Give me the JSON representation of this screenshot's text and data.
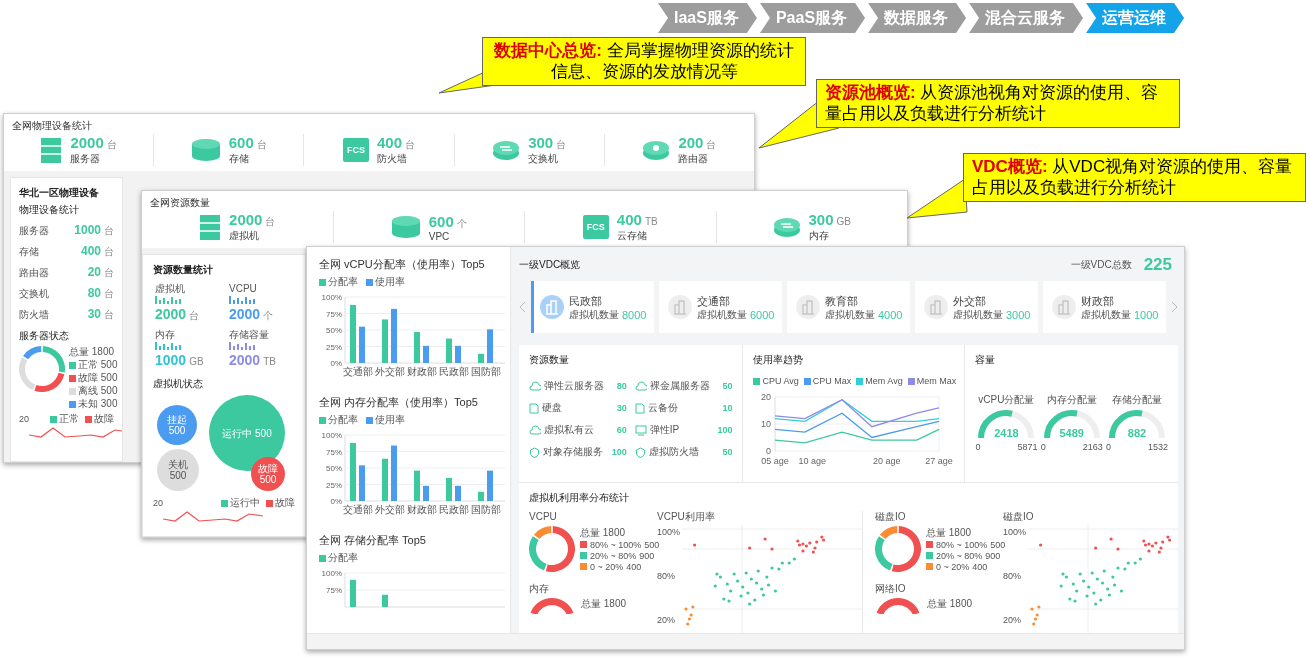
{
  "nav": {
    "steps": [
      {
        "label": "IaaS服务",
        "selected": false
      },
      {
        "label": "PaaS服务",
        "selected": false
      },
      {
        "label": "数据服务",
        "selected": false
      },
      {
        "label": "混合云服务",
        "selected": false
      },
      {
        "label": "运营运维",
        "selected": true
      }
    ]
  },
  "callouts": [
    {
      "text": "**数据中心总览:** 全局掌握物理资源的统计信息、资源的发放情况等"
    },
    {
      "text": "**资源池概览:** 从资源池视角对资源的使用、容量占用以及负载进行分析统计"
    },
    {
      "text": "**VDC概览:** 从VDC视角对资源的使用、容量占用以及负载进行分析统计"
    }
  ],
  "physical_overview": {
    "title": "全网物理设备统计",
    "stats": [
      {
        "kind": "server",
        "value": "2000",
        "unit": "台",
        "label": "服务器"
      },
      {
        "kind": "storage",
        "value": "600",
        "unit": "台",
        "label": "存储"
      },
      {
        "kind": "fcs",
        "icon_text": "FCS",
        "value": "400",
        "unit": "台",
        "label": "防火墙"
      },
      {
        "kind": "switch",
        "value": "300",
        "unit": "台",
        "label": "交换机"
      },
      {
        "kind": "router",
        "value": "200",
        "unit": "台",
        "label": "路由器"
      }
    ],
    "region": {
      "title": "华北一区物理设备",
      "subtitle": "物理设备统计",
      "rows": [
        {
          "label": "服务器",
          "value": "1000",
          "unit": "台"
        },
        {
          "label": "存储",
          "value": "400",
          "unit": "台"
        },
        {
          "label": "路由器",
          "value": "20",
          "unit": "台"
        },
        {
          "label": "交换机",
          "value": "80",
          "unit": "台"
        },
        {
          "label": "防火墙",
          "value": "30",
          "unit": "台"
        }
      ],
      "status": {
        "title": "服务器状态",
        "total": "总量 1800",
        "legend": [
          {
            "label": "正常 500",
            "color": "#3cc9a0"
          },
          {
            "label": "故障 500",
            "color": "#f05050"
          },
          {
            "label": "离线 500",
            "color": "#dddddd"
          },
          {
            "label": "未知 300",
            "color": "#4b9bf0"
          }
        ]
      },
      "trend": {
        "tick": "20",
        "legend": [
          {
            "label": "正常",
            "color": "#3cc9a0"
          },
          {
            "label": "故障",
            "color": "#f05050"
          }
        ]
      }
    }
  },
  "pool_overview": {
    "title": "全网资源数量",
    "stats": [
      {
        "kind": "server",
        "value": "2000",
        "unit": "台",
        "label": "虚拟机"
      },
      {
        "kind": "storage",
        "value": "600",
        "unit": "个",
        "label": "VPC"
      },
      {
        "kind": "fcs",
        "icon_text": "FCS",
        "value": "400",
        "unit": "TB",
        "label": "云存储"
      },
      {
        "kind": "switch",
        "value": "300",
        "unit": "GB",
        "label": "内存"
      }
    ],
    "resources": {
      "title": "资源数量统计",
      "items": [
        {
          "label": "虚拟机",
          "value": "2000",
          "unit": "台",
          "color": "#3cc9a0"
        },
        {
          "label": "VCPU",
          "value": "2000",
          "unit": "个",
          "color": "#4b9bf0"
        },
        {
          "label": "内存",
          "value": "1000",
          "unit": "GB",
          "color": "#2ec4d6"
        },
        {
          "label": "存储容量",
          "value": "2000",
          "unit": "TB",
          "color": "#8d8be6"
        }
      ]
    },
    "vm_status": {
      "title": "虚拟机状态",
      "bubbles": [
        {
          "label": "挂起",
          "value": "500",
          "color": "#4b9bf0"
        },
        {
          "label": "运行中",
          "value": "500",
          "color": "#3cc9a0"
        },
        {
          "label": "关机",
          "value": "500",
          "color": "#dddddd"
        },
        {
          "label": "故障",
          "value": "500",
          "color": "#f05050"
        }
      ],
      "trend": {
        "tick": "20",
        "legend": [
          {
            "label": "运行中",
            "color": "#3cc9a0"
          },
          {
            "label": "故障",
            "color": "#f05050"
          }
        ]
      }
    }
  },
  "vdc_overview": {
    "charts": [
      {
        "title": "全网 vCPU分配率（使用率）Top5",
        "chart_data": {
          "type": "bar",
          "categories": [
            "交通部",
            "外交部",
            "财政部",
            "民政部",
            "国防部"
          ],
          "series": [
            {
              "name": "分配率",
              "color": "#3cc9a0",
              "values": [
                88,
                66,
                47,
                37,
                14
              ]
            },
            {
              "name": "使用率",
              "color": "#4b9bf0",
              "values": [
                55,
                82,
                26,
                26,
                51
              ]
            }
          ],
          "grid": true,
          "ylim": [
            0,
            100
          ],
          "yticks": [
            {
              "value": 0,
              "label": "0%"
            },
            {
              "value": 25,
              "label": "25%"
            },
            {
              "value": 50,
              "label": "50%"
            },
            {
              "value": 75,
              "label": "75%"
            },
            {
              "value": 100,
              "label": "100%"
            }
          ]
        }
      },
      {
        "title": "全网 内存分配率（使用率）Top5",
        "chart_data": {
          "type": "bar",
          "categories": [
            "交通部",
            "外交部",
            "财政部",
            "民政部",
            "国防部"
          ],
          "series": [
            {
              "name": "分配率",
              "color": "#3cc9a0",
              "values": [
                88,
                64,
                46,
                35,
                14
              ]
            },
            {
              "name": "使用率",
              "color": "#4b9bf0",
              "values": [
                54,
                84,
                23,
                23,
                46
              ]
            }
          ],
          "grid": true,
          "ylim": [
            0,
            100
          ],
          "yticks": [
            {
              "value": 0,
              "label": "0%"
            },
            {
              "value": 25,
              "label": "25%"
            },
            {
              "value": 50,
              "label": "50%"
            },
            {
              "value": 75,
              "label": "75%"
            },
            {
              "value": 100,
              "label": "100%"
            }
          ]
        }
      },
      {
        "title": "全网 存储分配率 Top5",
        "chart_data": {
          "type": "bar",
          "series": [
            {
              "name": "分配率",
              "color": "#3cc9a0",
              "values": [
                90,
                68,
                null,
                null,
                null
              ]
            }
          ],
          "grid": true,
          "ylim": [
            50,
            100
          ],
          "yticks": [
            {
              "value": 75,
              "label": "75%"
            },
            {
              "value": 100,
              "label": "100%"
            }
          ]
        }
      }
    ],
    "vdc": {
      "title": "一级VDC概览",
      "total_label": "一级VDC总数",
      "total": "225",
      "cards": [
        {
          "name": "民政部",
          "metric": "虚拟机数量",
          "value": "8000",
          "selected": true
        },
        {
          "name": "交通部",
          "metric": "虚拟机数量",
          "value": "6000",
          "selected": false
        },
        {
          "name": "教育部",
          "metric": "虚拟机数量",
          "value": "4000",
          "selected": false
        },
        {
          "name": "外交部",
          "metric": "虚拟机数量",
          "value": "3000",
          "selected": false
        },
        {
          "name": "财政部",
          "metric": "虚拟机数量",
          "value": "1000",
          "selected": false
        }
      ]
    },
    "resources": {
      "title": "资源数量",
      "items": [
        {
          "kind": "cloud",
          "label": "弹性云服务器",
          "value": "80"
        },
        {
          "kind": "cloud",
          "label": "裸金属服务器",
          "value": "50"
        },
        {
          "kind": "disk",
          "label": "硬盘",
          "value": "30"
        },
        {
          "kind": "disk",
          "label": "云备份",
          "value": "10"
        },
        {
          "kind": "cloud",
          "label": "虚拟私有云",
          "value": "60"
        },
        {
          "kind": "screen",
          "label": "弹性IP",
          "value": "100"
        },
        {
          "kind": "shield",
          "label": "对象存储服务",
          "value": "100"
        },
        {
          "kind": "shield",
          "label": "虚拟防火墙",
          "value": "50"
        }
      ]
    },
    "trend": {
      "title": "使用率趋势",
      "chart_data": {
        "type": "line",
        "x": [
          5,
          9,
          14,
          18,
          24,
          27
        ],
        "series": [
          {
            "name": "CPU Avg",
            "color": "#3cc9a0",
            "values": [
              4,
              3,
              7,
              4,
              4,
              8
            ]
          },
          {
            "name": "CPU Max",
            "color": "#4b9bf0",
            "values": [
              8,
              7,
              14,
              5,
              9,
              11
            ]
          },
          {
            "name": "Mem Avg",
            "color": "#2ecfd8",
            "values": [
              12,
              11,
              19,
              11,
              11,
              12
            ]
          },
          {
            "name": "Mem Max",
            "color": "#8d8be6",
            "values": [
              13,
              12,
              19,
              9,
              14,
              16
            ]
          }
        ],
        "grid": true,
        "ylim": [
          0,
          20
        ],
        "yticks": [
          0,
          10,
          20
        ],
        "xlim": [
          5,
          27
        ],
        "xticks": [
          {
            "value": 5,
            "label": "05 age"
          },
          {
            "value": 10,
            "label": "10 age"
          },
          {
            "value": 20,
            "label": "20 age"
          },
          {
            "value": 27,
            "label": "27 age"
          }
        ]
      }
    },
    "capacity": {
      "title": "容量",
      "gauges": [
        {
          "label": "vCPU分配量",
          "value": "2418",
          "min": "0",
          "max": "5871",
          "level": 0.62
        },
        {
          "label": "内存分配量",
          "value": "5489",
          "min": "0",
          "max": "2163",
          "level": 0.6
        },
        {
          "label": "存储分配量",
          "value": "882",
          "min": "0",
          "max": "1532",
          "level": 0.6
        }
      ]
    },
    "distribution": {
      "title": "虚拟机利用率分布统计",
      "panels": [
        {
          "donut_title": "VCPU",
          "total": "总量 1800",
          "legend": [
            {
              "label": "80% ~ 100%",
              "value": "500",
              "color": "#f05050"
            },
            {
              "label": "20% ~ 80%",
              "value": "900",
              "color": "#3cc9a0"
            },
            {
              "label": "0 ~ 20%",
              "value": "400",
              "color": "#fa8c35"
            }
          ],
          "scatter_title": "VCPU利用率",
          "scatter_ticks": [
            "100%",
            "80%",
            "20%"
          ],
          "next_title": "内存",
          "next_total": "总量 1800"
        },
        {
          "donut_title": "磁盘IO",
          "total": "总量 1800",
          "legend": [
            {
              "label": "80% ~ 100%",
              "value": "500",
              "color": "#f05050"
            },
            {
              "label": "20% ~ 80%",
              "value": "900",
              "color": "#3cc9a0"
            },
            {
              "label": "0 ~ 20%",
              "value": "400",
              "color": "#fa8c35"
            }
          ],
          "scatter_title": "磁盘IO",
          "scatter_ticks": [
            "100%",
            "80%",
            "20%"
          ],
          "next_title": "网络IO",
          "next_total": "总量 1800"
        }
      ]
    }
  }
}
